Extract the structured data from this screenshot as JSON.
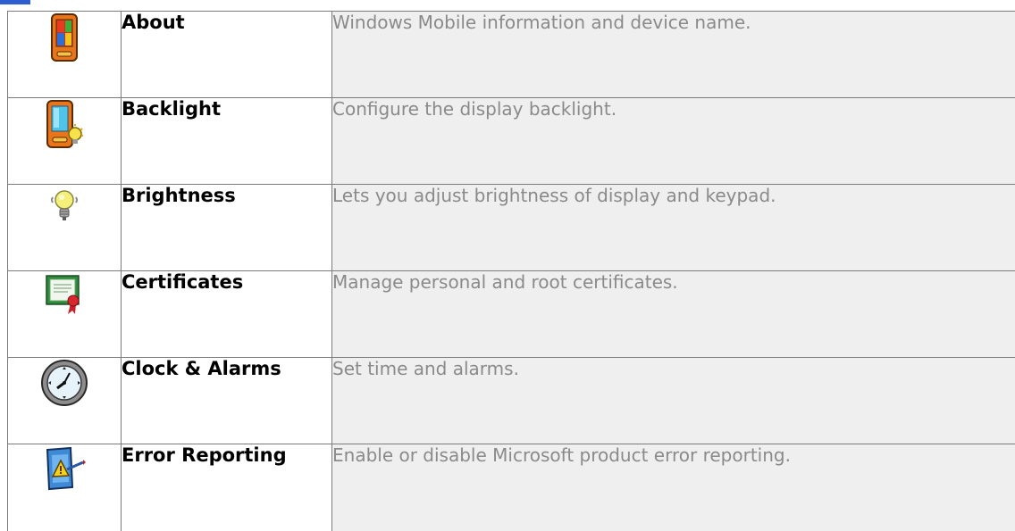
{
  "settings_rows": [
    {
      "icon": "pda-windows-icon",
      "name": "About",
      "description": "Windows Mobile information and device name."
    },
    {
      "icon": "pda-backlight-icon",
      "name": "Backlight",
      "description": "Configure the display backlight."
    },
    {
      "icon": "lightbulb-icon",
      "name": "Brightness",
      "description": "Lets you adjust brightness of display and keypad."
    },
    {
      "icon": "certificate-icon",
      "name": "Certificates",
      "description": "Manage personal and root certificates."
    },
    {
      "icon": "clock-icon",
      "name": "Clock & Alarms",
      "description": "Set time and alarms."
    },
    {
      "icon": "error-report-icon",
      "name": "Error Reporting",
      "description": "Enable or disable Microsoft product error reporting."
    }
  ],
  "colors": {
    "accent": "#2e5fd0",
    "border": "#7b7b7b",
    "description_bg": "#efefef",
    "description_text": "#8a8a8a"
  }
}
